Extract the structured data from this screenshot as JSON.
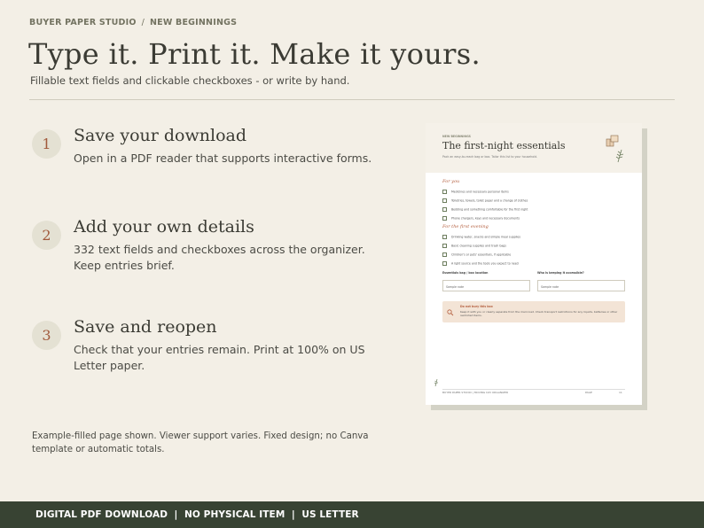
{
  "breadcrumb": {
    "brand": "BUYER PAPER STUDIO",
    "separator": "/",
    "collection": "NEW BEGINNINGS"
  },
  "hero": {
    "title": "Type it. Print it. Make it yours.",
    "subtitle": "Fillable text fields and clickable checkboxes - or write by hand."
  },
  "steps": [
    {
      "number": "1",
      "title": "Save your download",
      "desc": "Open in a PDF reader that supports interactive forms."
    },
    {
      "number": "2",
      "title": "Add your own details",
      "desc": "332 text fields and checkboxes across the organizer. Keep entries brief."
    },
    {
      "number": "3",
      "title": "Save and reopen",
      "desc": "Check that your entries remain. Print at 100% on US Letter paper."
    }
  ],
  "footnote": "Example-filled page shown. Viewer support varies. Fixed design; no Canva template or automatic totals.",
  "banner": {
    "text": "DIGITAL PDF DOWNLOAD  |  NO PHYSICAL ITEM  |  US LETTER"
  },
  "preview": {
    "kicker": "NEW BEGINNINGS",
    "title": "The first-night essentials",
    "intro": "Pack an easy-to-reach bag or box. Tailor this list to your household.",
    "section1": "For you",
    "section1_items": [
      "Medicines and necessary personal items",
      "Toiletries, towels, toilet paper and a change of clothes",
      "Bedding and something comfortable for the first night",
      "Phone chargers, keys and necessary documents"
    ],
    "section2": "For the first evening",
    "section2_items": [
      "Drinking water, snacks and simple meal supplies",
      "Basic cleaning supplies and trash bags",
      "Children's or pets' essentials, if applicable",
      "A light source and the tools you expect to need"
    ],
    "field1_label": "Essentials bag / box location",
    "field1_value": "Sample note",
    "field2_label": "Who is keeping it accessible?",
    "field2_value": "Sample note",
    "tip_title": "Do not bury this box",
    "tip_text": "Keep it with you or clearly separate from the main load. Check transport restrictions for any liquids, batteries or other restricted items.",
    "footer_left": "BUYER PAPER STUDIO  |  MOVING DAY ORGANIZER",
    "footer_mid": "PAGE",
    "footer_right": "11"
  },
  "colors": {
    "accent": "#a15a3c",
    "banner_bg": "#384333",
    "page_bg": "#f3efe6",
    "circle_bg": "#e4e1d3"
  }
}
